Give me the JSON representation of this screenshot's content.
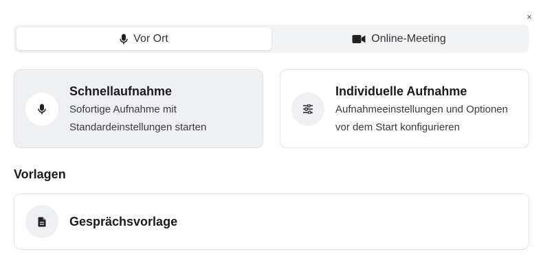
{
  "dialog": {
    "close_label": "×"
  },
  "tabs": [
    {
      "label": "Vor Ort",
      "icon": "microphone-icon",
      "active": true
    },
    {
      "label": "Online-Meeting",
      "icon": "video-camera-icon",
      "active": false
    }
  ],
  "options": [
    {
      "title": "Schnellaufnahme",
      "description_line1": "Sofortige Aufnahme mit",
      "description_line2": "Standardeinstellungen starten",
      "icon": "microphone-icon",
      "selected": true
    },
    {
      "title": "Individuelle Aufnahme",
      "description_line1": "Aufnahmeeinstellungen und Optionen",
      "description_line2": "vor dem Start konfigurieren",
      "icon": "sliders-icon",
      "selected": false
    }
  ],
  "templates": {
    "heading": "Vorlagen",
    "items": [
      {
        "title": "Gesprächsvorlage",
        "icon": "document-icon"
      }
    ]
  },
  "colors": {
    "selected_card_bg": "#eff0f3",
    "tab_bar_bg": "#f3f4f6",
    "border": "#e2e4e8"
  }
}
